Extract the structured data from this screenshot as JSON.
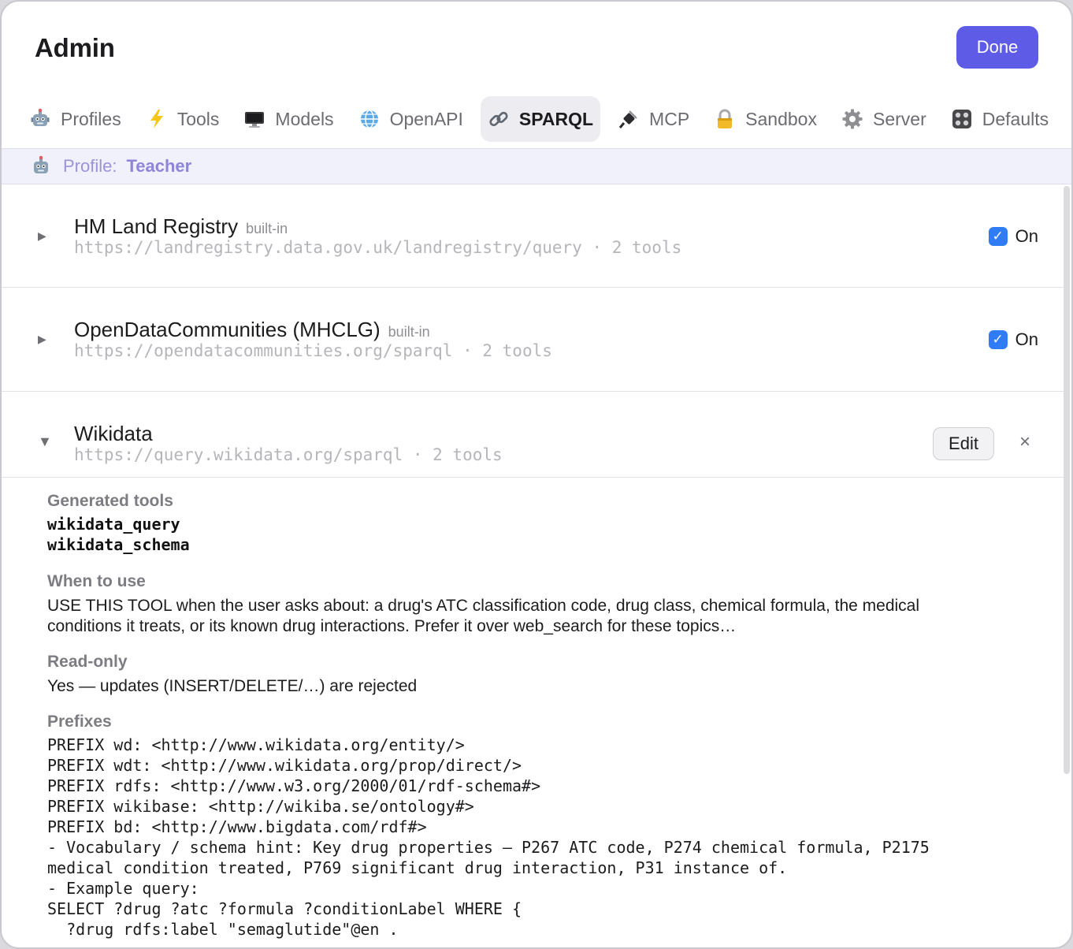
{
  "header": {
    "title": "Admin",
    "done_label": "Done"
  },
  "tabs": [
    {
      "label": "Profiles",
      "icon": "robot-icon"
    },
    {
      "label": "Tools",
      "icon": "lightning-icon"
    },
    {
      "label": "Models",
      "icon": "monitor-icon"
    },
    {
      "label": "OpenAPI",
      "icon": "globe-icon"
    },
    {
      "label": "SPARQL",
      "icon": "link-icon",
      "active": true
    },
    {
      "label": "MCP",
      "icon": "plug-icon"
    },
    {
      "label": "Sandbox",
      "icon": "lock-icon"
    },
    {
      "label": "Server",
      "icon": "gear-icon"
    },
    {
      "label": "Defaults",
      "icon": "control-knobs-icon"
    }
  ],
  "profile": {
    "label": "Profile:",
    "value": "Teacher"
  },
  "endpoints": [
    {
      "name": "HM Land Registry",
      "badge": "built-in",
      "subtitle": "https://landregistry.data.gov.uk/landregistry/query · 2 tools",
      "toggle_label": "On",
      "enabled": true
    },
    {
      "name": "OpenDataCommunities (MHCLG)",
      "badge": "built-in",
      "subtitle": "https://opendatacommunities.org/sparql · 2 tools",
      "toggle_label": "On",
      "enabled": true
    },
    {
      "name": "Wikidata",
      "subtitle": "https://query.wikidata.org/sparql · 2 tools",
      "edit_label": "Edit",
      "close_symbol": "×",
      "expanded": true
    }
  ],
  "details": {
    "generated_tools_label": "Generated tools",
    "generated_tools": [
      "wikidata_query",
      "wikidata_schema"
    ],
    "when_to_use_label": "When to use",
    "when_to_use_line1": "USE THIS TOOL when the user asks about: a drug's ATC classification code, drug class, chemical formula, the medical",
    "when_to_use_line2": "conditions it treats, or its known drug interactions. Prefer it over web_search for these topics…",
    "read_only_label": "Read-only",
    "read_only_text": "Yes — updates (INSERT/DELETE/…) are rejected",
    "prefixes_label": "Prefixes",
    "prefixes_lines": [
      "PREFIX wd: <http://www.wikidata.org/entity/>",
      "PREFIX wdt: <http://www.wikidata.org/prop/direct/>",
      "PREFIX rdfs: <http://www.w3.org/2000/01/rdf-schema#>",
      "PREFIX wikibase: <http://wikiba.se/ontology#>",
      "PREFIX bd: <http://www.bigdata.com/rdf#>",
      "- Vocabulary / schema hint: Key drug properties — P267 ATC code, P274 chemical formula, P2175",
      "medical condition treated, P769 significant drug interaction, P31 instance of.",
      "- Example query:",
      "SELECT ?drug ?atc ?formula ?conditionLabel WHERE {",
      "  ?drug rdfs:label \"semaglutide\"@en ."
    ]
  }
}
